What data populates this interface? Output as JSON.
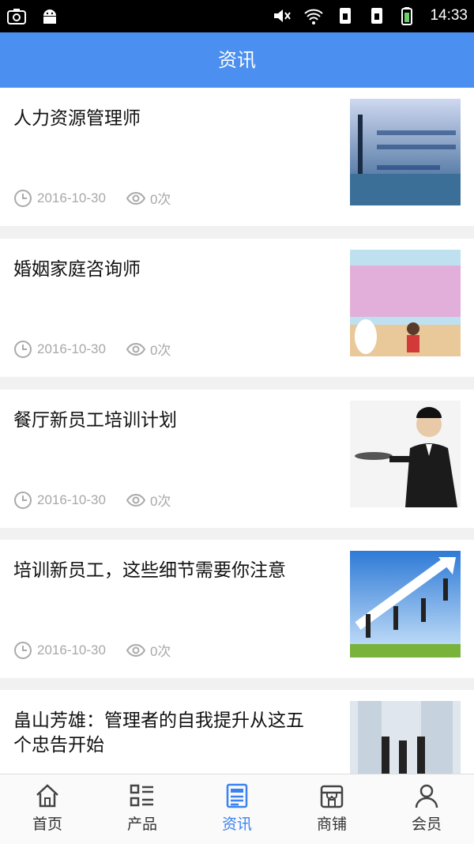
{
  "status_bar": {
    "time": "14:33",
    "icons": [
      "screenshot-icon",
      "android-icon",
      "mute-icon",
      "wifi-icon",
      "sim1-icon",
      "sim2-icon",
      "battery-icon"
    ]
  },
  "header": {
    "title": "资讯"
  },
  "articles": [
    {
      "title": "人力资源管理师",
      "date": "2016-10-30",
      "views": "0次"
    },
    {
      "title": "婚姻家庭咨询师",
      "date": "2016-10-30",
      "views": "0次"
    },
    {
      "title": "餐厅新员工培训计划",
      "date": "2016-10-30",
      "views": "0次"
    },
    {
      "title": "培训新员工，这些细节需要你注意",
      "date": "2016-10-30",
      "views": "0次"
    },
    {
      "title": "畠山芳雄：管理者的自我提升从这五个忠告开始",
      "date": "",
      "views": ""
    }
  ],
  "tabs": [
    {
      "label": "首页",
      "icon": "home-icon"
    },
    {
      "label": "产品",
      "icon": "list-icon"
    },
    {
      "label": "资讯",
      "icon": "news-icon"
    },
    {
      "label": "商铺",
      "icon": "shop-icon"
    },
    {
      "label": "会员",
      "icon": "user-icon"
    }
  ],
  "colors": {
    "accent": "#4b8ff0",
    "active_tab": "#3b82f0",
    "meta_text": "#a8a8a8"
  }
}
